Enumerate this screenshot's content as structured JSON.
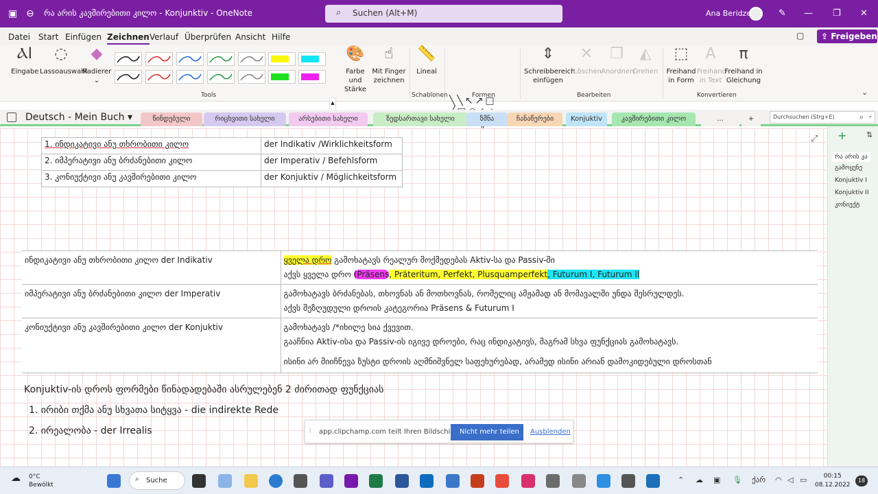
{
  "titlebar": {
    "title": "რა არის კავშირებითი კილო - Konjunktiv - OneNote",
    "search_placeholder": "Suchen (Alt+M)",
    "user": "Ana Beridze"
  },
  "menu": [
    "Datei",
    "Start",
    "Einfügen",
    "Zeichnen",
    "Verlauf",
    "Überprüfen",
    "Ansicht",
    "Hilfe"
  ],
  "menu_active": "Zeichnen",
  "share_label": "Freigeben",
  "ribbon": {
    "eingabe": "Eingabe",
    "lasso": "Lassoauswahl",
    "radierer": "Radierer",
    "farbe": "Farbe und Stärke",
    "finger": "Mit Finger zeichnen",
    "lineal": "Lineal",
    "schreibbereich": "Schreibbereich einfügen",
    "loeschen": "Löschen",
    "anordnen": "Anordnen",
    "drehen": "Drehen",
    "freihand_form": "Freihand in Form",
    "freihand_text": "Freihand in Text",
    "freihand_gleichung": "Freihand in Gleichung",
    "groups": {
      "tools": "Tools",
      "schablonen": "Schablonen",
      "formen": "Formen",
      "bearbeiten": "Bearbeiten",
      "konvertieren": "Konvertieren"
    },
    "pen_colors": [
      "#222222",
      "#d9362f",
      "#2f6fd9",
      "#2e9a4a",
      "#888888",
      "#f7f70a",
      "#12e6f5",
      "#222222",
      "#d9362f",
      "#2f6fd9",
      "#2e9a4a",
      "#888888",
      "#21e021",
      "#ee22ee"
    ]
  },
  "notebook": "Deutsch - Mein Buch",
  "tabs": [
    {
      "label": "წინდებული",
      "color": "#f3c7c7"
    },
    {
      "label": "რიცხვითი სახელი",
      "color": "#d6c9f0"
    },
    {
      "label": "არსებითი სახელი",
      "color": "#f2c9ef"
    },
    {
      "label": "ზედსართავი სახელი",
      "color": "#c9edc5"
    },
    {
      "label": "ზმნა",
      "color": "#c9dff5"
    },
    {
      "label": "ჩანაწერები",
      "color": "#f7d6b5"
    },
    {
      "label": "Konjuktiv",
      "color": "#bfe3f7"
    },
    {
      "label": "კავშირებითი კილო",
      "color": "#a6e6b0"
    },
    {
      "label": "...",
      "color": "#f3f2f1"
    },
    {
      "label": "+",
      "color": "#f3f2f1"
    }
  ],
  "section_search": "Durchsuchen (Strg+E)",
  "pages": [
    "რა არის კა",
    "გამოყენე",
    "Konjuktiv I",
    "Konjuktiv II",
    "კონიუქტ"
  ],
  "table1": [
    {
      "ka": "1. ინდიკატივი ანუ თხრობითი კილო",
      "de": "der Indikativ /Wirklichkeitsform"
    },
    {
      "ka": "2. იმპერატივი ანუ ბრძანებითი კილო",
      "de": "der Imperativ / Befehlsform"
    },
    {
      "ka": "3. კონიუქტივი ანუ კავშირებითი კილო",
      "de": "der Konjuktiv / Möglichkeitsform"
    }
  ],
  "table2": {
    "r1c1": "ინდიკატივი ანუ თხრობითი კილო der Indikativ",
    "r1_hl": "ყველა დრო",
    "r1_l1": " გამოხატავს რეალურ მოქმედებას Aktiv-სა და Passiv-ში",
    "r1_l2a": "აქვს ყველა დრო ",
    "r1_praesens": "(Präsens",
    "r1_yellow": ", Präteritum, Perfekt, Plusquamperfekt",
    "r1_cyan": ", Futurum I, Futurum II",
    "r2c1": "იმპერატივი ანუ ბრძანებითი კილო der Imperativ",
    "r2_l1": "გამოხატავს ბრძანებას, თხოვნას ან მოთხოვნას, რომელიც ამჟამად ან მომავალში უნდა შესრულდეს.",
    "r2_l2": "აქვს შეზღუდული დროის კატეგორია Präsens & Futurum I",
    "r3c1": "კონიუქტივი ანუ კავშირებითი კილო der Konjuktiv",
    "r3_l1": "გამოხატავს /*იხილე სია ქვევით.",
    "r3_l2": "გააჩნია Aktiv-ისა და Passiv-ის იგივე დროები, რაც ინდიკატივს, მაგრამ სხვა ფუნქციას გამოხატავს.",
    "r3_l3": "ისინი არ მიიჩნევა ზუსტი დროის აღმნიშვნელ საფეხურებად, არამედ ისინი არიან დამოკიდებული დროსთან"
  },
  "body": {
    "p1": "Konjuktiv-ის დროს ფორმები წინადადებაში ასრულებენ 2 ძირითად ფუნქციას",
    "li1": "1.   ირიბი თქმა ანუ სხვათა სიტყვა  -  die indirekte Rede",
    "li2": "2.   ირეალობა   -  der Irrealis"
  },
  "share_note": {
    "msg": "app.clipchamp.com teilt Ihren Bildschirm.",
    "stop": "Nicht mehr teilen",
    "hide": "Ausblenden"
  },
  "taskbar": {
    "temp": "0°C",
    "weather": "Bewölkt",
    "search": "Suche",
    "lang": "ქარ",
    "time": "00:15",
    "date": "08.12.2022",
    "badge": "18"
  }
}
